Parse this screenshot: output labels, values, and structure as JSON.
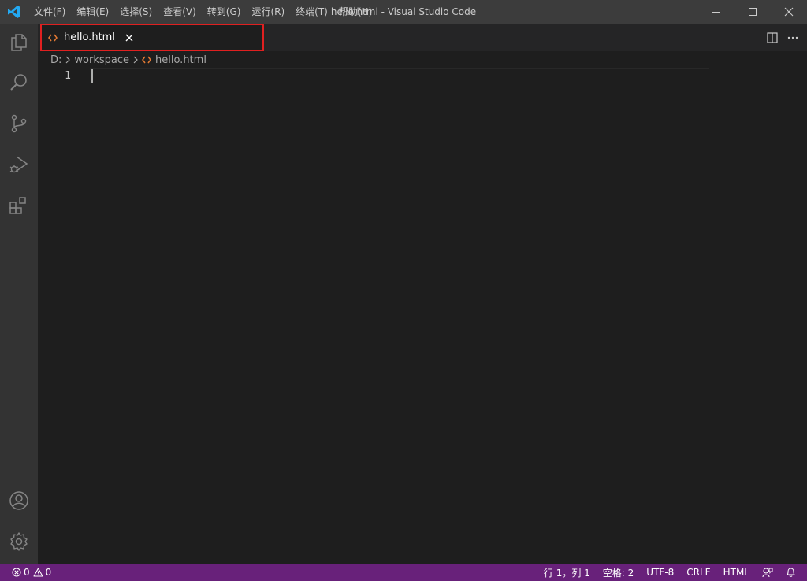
{
  "window": {
    "title": "hello.html - Visual Studio Code"
  },
  "menu": [
    {
      "label": "文件(F)"
    },
    {
      "label": "编辑(E)"
    },
    {
      "label": "选择(S)"
    },
    {
      "label": "查看(V)"
    },
    {
      "label": "转到(G)"
    },
    {
      "label": "运行(R)"
    },
    {
      "label": "终端(T)"
    },
    {
      "label": "帮助(H)"
    }
  ],
  "activity_bar": {
    "top": [
      "explorer-icon",
      "search-icon",
      "source-control-icon",
      "run-debug-icon",
      "extensions-icon"
    ],
    "bottom": [
      "account-icon",
      "settings-gear-icon"
    ]
  },
  "tab": {
    "label": "hello.html",
    "icon": "html-file-icon"
  },
  "breadcrumb": {
    "drive": "D:",
    "folder": "workspace",
    "file": "hello.html"
  },
  "editor": {
    "line_number": "1"
  },
  "status": {
    "errors": "0",
    "warnings": "0",
    "position": "行 1，列 1",
    "spaces": "空格: 2",
    "encoding": "UTF-8",
    "eol": "CRLF",
    "language": "HTML"
  },
  "colors": {
    "statusbar": "#68217a",
    "html_icon": "#e37933",
    "tab_highlight": "#e02020",
    "vscode_blue": "#23a9f2"
  }
}
